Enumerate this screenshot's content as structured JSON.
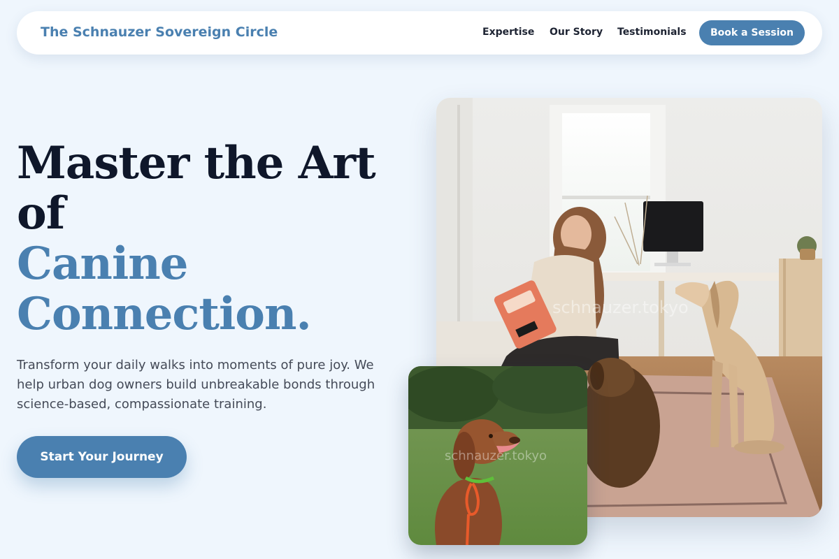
{
  "nav": {
    "brand": "The Schnauzer Sovereign Circle",
    "links": [
      "Expertise",
      "Our Story",
      "Testimonials"
    ],
    "cta": "Book a Session"
  },
  "hero": {
    "title_line1": "Master the Art",
    "title_line2": "of",
    "title_accent1": "Canine",
    "title_accent2": "Connection.",
    "subtitle": "Transform your daily walks into moments of pure joy. We help urban dog owners build unbreakable bonds through science-based, compassionate training.",
    "cta": "Start Your Journey"
  },
  "images": {
    "main_watermark": "schnauzer.tokyo",
    "inset_watermark": "schnauzer.tokyo"
  },
  "colors": {
    "accent": "#4a80b0",
    "heading": "#0f172a",
    "background": "#eff6fd"
  }
}
